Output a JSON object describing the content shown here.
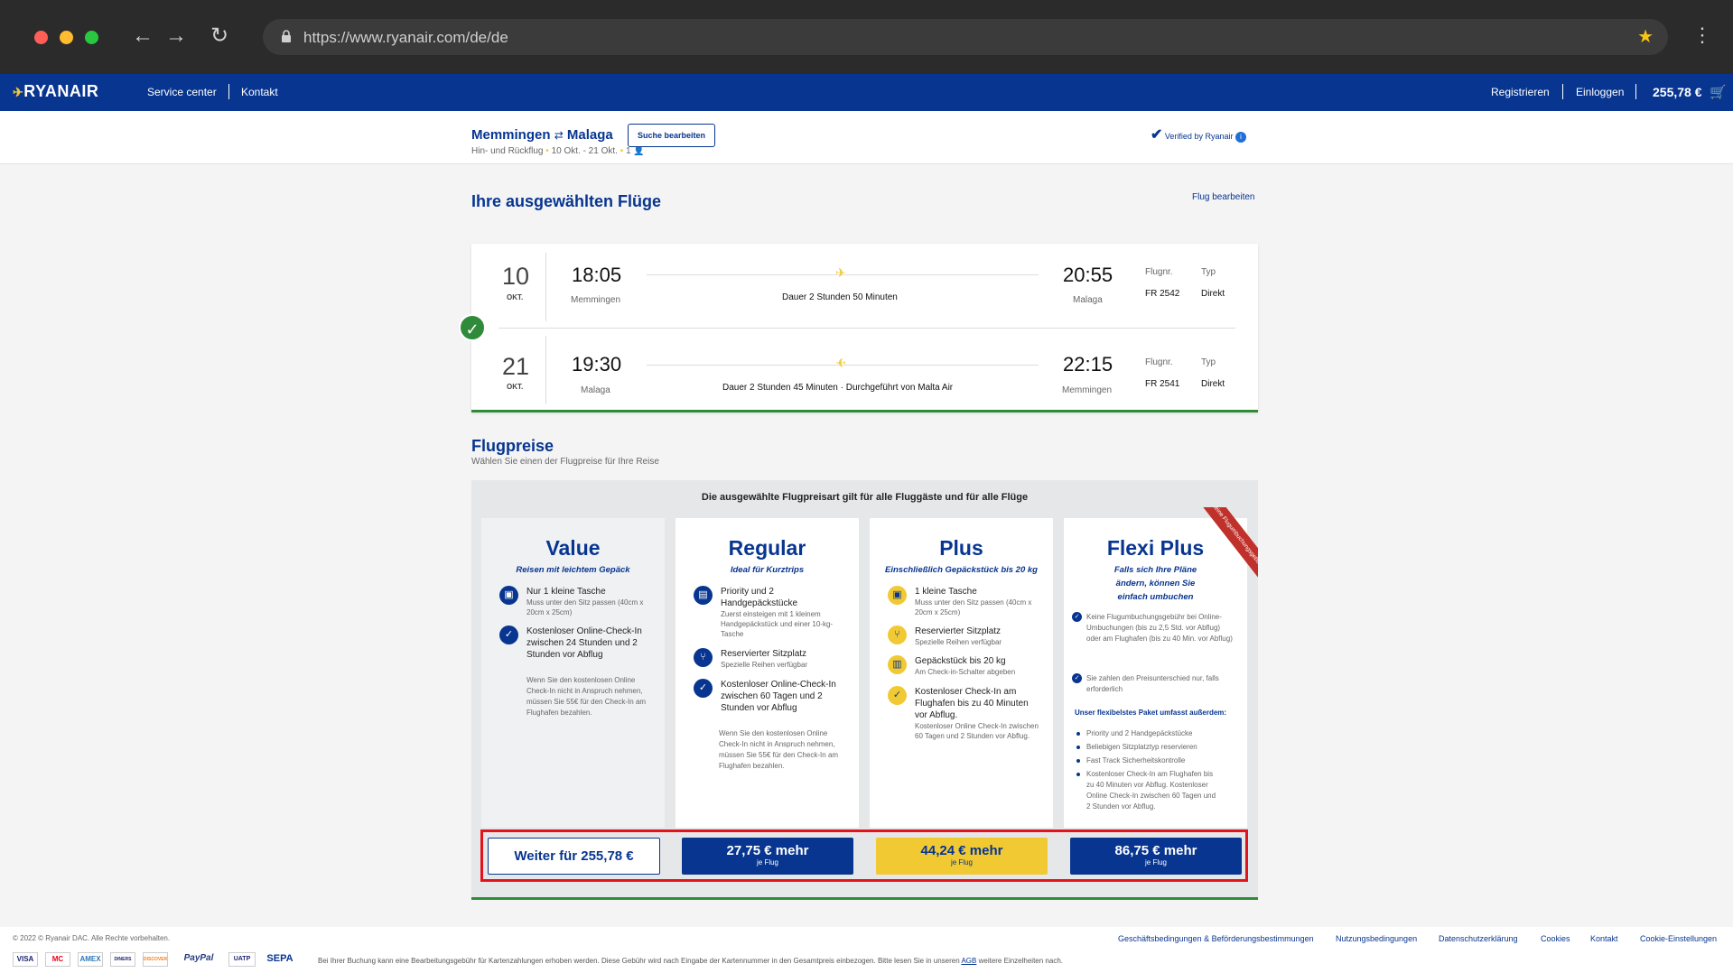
{
  "browser": {
    "url": "https://www.ryanair.com/de/de"
  },
  "nav": {
    "logo": "RYANAIR",
    "service": "Service center",
    "contact": "Kontakt",
    "register": "Registrieren",
    "login": "Einloggen",
    "cart_total": "255,78 €"
  },
  "search": {
    "origin": "Memmingen",
    "destination": "Malaga",
    "edit_label": "Suche bearbeiten",
    "details": "Hin- und Rückflug",
    "dates": "10 Okt. - 21 Okt.",
    "passengers": "1",
    "verified": "Verified by Ryanair"
  },
  "selected": {
    "title": "Ihre ausgewählten Flüge",
    "edit_link": "Flug bearbeiten"
  },
  "flights": [
    {
      "day": "10",
      "month": "OKT.",
      "dep_time": "18:05",
      "dep_place": "Memmingen",
      "duration": "Dauer 2 Stunden 50 Minuten",
      "arr_time": "20:55",
      "arr_place": "Malaga",
      "flight_no_label": "Flugnr.",
      "flight_no": "FR 2542",
      "type_label": "Typ",
      "type": "Direkt"
    },
    {
      "day": "21",
      "month": "OKT.",
      "dep_time": "19:30",
      "dep_place": "Malaga",
      "duration": "Dauer 2 Stunden 45 Minuten · Durchgeführt von Malta Air",
      "arr_time": "22:15",
      "arr_place": "Memmingen",
      "flight_no_label": "Flugnr.",
      "flight_no": "FR 2541",
      "type_label": "Typ",
      "type": "Direkt"
    }
  ],
  "fares": {
    "title": "Flugpreise",
    "subtitle": "Wählen Sie einen der Flugpreise für Ihre Reise",
    "note": "Die ausgewählte Flugpreisart gilt für alle Fluggäste und für alle Flüge",
    "ribbon": "Keine Flugumbuchungsgebühr",
    "value": {
      "name": "Value",
      "tagline": "Reisen mit leichtem Gepäck",
      "f1_title": "Nur 1 kleine Tasche",
      "f1_sub": "Muss unter den Sitz passen (40cm x 20cm x 25cm)",
      "f2_title": "Kostenloser Online-Check-In zwischen 24 Stunden und 2 Stunden vor Abflug",
      "note": "Wenn Sie den kostenlosen Online Check-In nicht in Anspruch nehmen, müssen Sie 55€ für den Check-In am Flughafen bezahlen.",
      "button": "Weiter für 255,78 €"
    },
    "regular": {
      "name": "Regular",
      "tagline": "Ideal für Kurztrips",
      "f1_title": "Priority und 2 Handgepäckstücke",
      "f1_sub": "Zuerst einsteigen mit 1 kleinem Handgepäckstück und einer 10-kg-Tasche",
      "f2_title": "Reservierter Sitzplatz",
      "f2_sub": "Spezielle Reihen verfügbar",
      "f3_title": "Kostenloser Online-Check-In zwischen 60 Tagen und 2 Stunden vor Abflug",
      "note": "Wenn Sie den kostenlosen Online Check-In nicht in Anspruch nehmen, müssen Sie 55€ für den Check-In am Flughafen bezahlen.",
      "button": "27,75 € mehr",
      "button_sub": "je Flug"
    },
    "plus": {
      "name": "Plus",
      "tagline": "Einschließlich Gepäckstück bis 20 kg",
      "f1_title": "1 kleine Tasche",
      "f1_sub": "Muss unter den Sitz passen (40cm x 20cm x 25cm)",
      "f2_title": "Reservierter Sitzplatz",
      "f2_sub": "Spezielle Reihen verfügbar",
      "f3_title": "Gepäckstück bis 20 kg",
      "f3_sub": "Am Check-in-Schalter abgeben",
      "f4_title": "Kostenloser Check-In am Flughafen bis zu 40 Minuten vor Abflug.",
      "f4_sub": "Kostenloser Online Check-In zwischen 60 Tagen und 2 Stunden vor Abflug.",
      "button": "44,24 € mehr",
      "button_sub": "je Flug"
    },
    "flexi": {
      "name": "Flexi Plus",
      "tagline": "Falls sich Ihre Pläne ändern, können Sie einfach umbuchen",
      "c1": "Keine Flugumbuchungsgebühr bei Online-Umbuchungen (bis zu 2,5 Std. vor Abflug) oder am Flughafen (bis zu 40 Min. vor Abflug)",
      "c2": "Sie zahlen den Preisunterschied nur, falls erforderlich",
      "package": "Unser flexibelstes Paket umfasst außerdem:",
      "b1": "Priority und 2 Handgepäckstücke",
      "b2": "Beliebigen Sitzplatztyp reservieren",
      "b3": "Fast Track Sicherheitskontrolle",
      "b4": "Kostenloser Check-In am Flughafen bis zu 40 Minuten vor Abflug. Kostenloser Online Check-In zwischen 60 Tagen und 2 Stunden vor Abflug.",
      "button": "86,75 € mehr",
      "button_sub": "je Flug"
    }
  },
  "footer": {
    "copyright": "© 2022 © Ryanair DAC. Alle Rechte vorbehalten.",
    "links": [
      "Geschäftsbedingungen & Beförderungsbestimmungen",
      "Nutzungsbedingungen",
      "Datenschutzerklärung",
      "Cookies",
      "Kontakt",
      "Cookie-Einstellungen"
    ],
    "fee_text": "Bei Ihrer Buchung kann eine Bearbeitungsgebühr für Kartenzahlungen erhoben werden. Diese Gebühr wird nach Eingabe der Kartennummer in den Gesamtpreis einbezogen. Bitte lesen Sie in unseren",
    "fee_link": "AGB",
    "fee_tail": "weitere Einzelheiten nach.",
    "payments": [
      "VISA",
      "MC",
      "AMEX",
      "DINERS",
      "DISCOVER",
      "PayPal",
      "UATP",
      "SEPA"
    ]
  },
  "colors": {
    "brand_blue": "#073590",
    "brand_yellow": "#f1c933",
    "success": "#2f8b3a",
    "highlight": "#e2141b"
  }
}
